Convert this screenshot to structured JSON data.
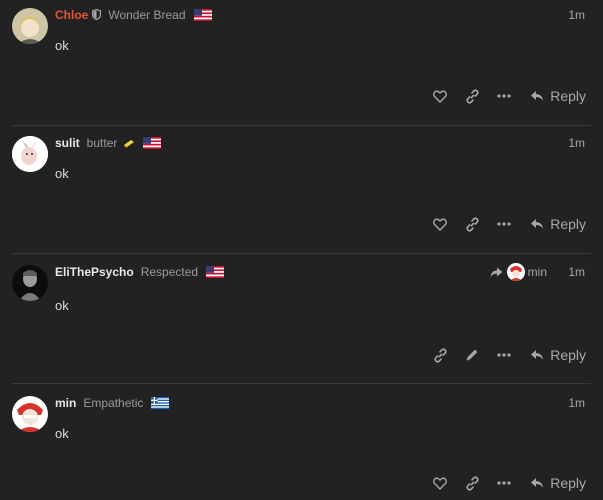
{
  "posts": [
    {
      "username": "Chloe",
      "title": "Wonder Bread",
      "age": "1m",
      "body": "ok",
      "actions": [
        "like",
        "link",
        "more"
      ],
      "reply": "Reply",
      "flag": "us-flag"
    },
    {
      "username": "sulit",
      "title": "butter",
      "age": "1m",
      "body": "ok",
      "actions": [
        "like",
        "link",
        "more"
      ],
      "reply": "Reply",
      "flag": "us-flag"
    },
    {
      "username": "EliThePsycho",
      "title": "Respected",
      "age": "1m",
      "body": "ok",
      "actions": [
        "link",
        "edit",
        "more"
      ],
      "reply": "Reply",
      "reply_to": "min",
      "flag": "us-flag"
    },
    {
      "username": "min",
      "title": "Empathetic",
      "age": "1m",
      "body": "ok",
      "actions": [
        "like",
        "link",
        "more"
      ],
      "reply": "Reply",
      "flag": "greek-flag"
    }
  ],
  "colors": {
    "background": "#222222",
    "staff_name": "#e45735",
    "muted": "#a8a8a8"
  }
}
